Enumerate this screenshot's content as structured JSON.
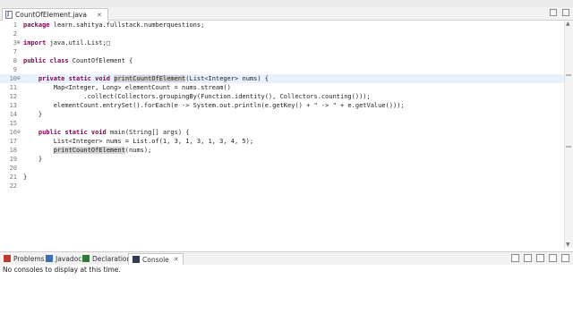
{
  "editor": {
    "tab_title": "CountOfElement.java",
    "tab_close": "✕",
    "current_line": 10,
    "lines": [
      {
        "n": "1",
        "fold": "",
        "segs": [
          {
            "t": "package",
            "k": 1
          },
          {
            "t": " learn.sahitya.fullstack.numberquestions;"
          }
        ]
      },
      {
        "n": "2",
        "fold": "",
        "segs": []
      },
      {
        "n": "3",
        "fold": "⊕",
        "segs": [
          {
            "t": "import",
            "k": 1
          },
          {
            "t": " java.util.List;□"
          }
        ]
      },
      {
        "n": "7",
        "fold": "",
        "segs": []
      },
      {
        "n": "8",
        "fold": "",
        "segs": [
          {
            "t": "public",
            "k": 1
          },
          {
            "t": " "
          },
          {
            "t": "class",
            "k": 1
          },
          {
            "t": " CountOfElement {"
          }
        ]
      },
      {
        "n": "9",
        "fold": "",
        "segs": []
      },
      {
        "n": "10",
        "fold": "⊖",
        "segs": [
          {
            "t": "    "
          },
          {
            "t": "private",
            "k": 1
          },
          {
            "t": " "
          },
          {
            "t": "static",
            "k": 1
          },
          {
            "t": " "
          },
          {
            "t": "void",
            "k": 1
          },
          {
            "t": " "
          },
          {
            "t": "printCountOfElement",
            "h": 1
          },
          {
            "t": "(List<Integer> nums) {"
          }
        ]
      },
      {
        "n": "11",
        "fold": "",
        "segs": [
          {
            "t": "        Map<Integer, Long> elementCount = nums.stream()"
          }
        ]
      },
      {
        "n": "12",
        "fold": "",
        "segs": [
          {
            "t": "                .collect(Collectors.groupingBy(Function.identity(), Collectors.counting()));"
          }
        ]
      },
      {
        "n": "13",
        "fold": "",
        "segs": [
          {
            "t": "        elementCount.entrySet().forEach(e -> System.out.println(e.getKey() + \" -> \" + e.getValue()));"
          }
        ]
      },
      {
        "n": "14",
        "fold": "",
        "segs": [
          {
            "t": "    }"
          }
        ]
      },
      {
        "n": "15",
        "fold": "",
        "segs": []
      },
      {
        "n": "16",
        "fold": "⊖",
        "segs": [
          {
            "t": "    "
          },
          {
            "t": "public",
            "k": 1
          },
          {
            "t": " "
          },
          {
            "t": "static",
            "k": 1
          },
          {
            "t": " "
          },
          {
            "t": "void",
            "k": 1
          },
          {
            "t": " main(String[] args) {"
          }
        ]
      },
      {
        "n": "17",
        "fold": "",
        "segs": [
          {
            "t": "        List<Integer> nums = List.of(1, 3, 1, 3, 1, 3, 4, 5);"
          }
        ]
      },
      {
        "n": "18",
        "fold": "",
        "segs": [
          {
            "t": "        "
          },
          {
            "t": "printCountOfElement",
            "h": 1
          },
          {
            "t": "(nums);"
          }
        ]
      },
      {
        "n": "19",
        "fold": "",
        "segs": [
          {
            "t": "    }"
          }
        ]
      },
      {
        "n": "20",
        "fold": "",
        "segs": []
      },
      {
        "n": "21",
        "fold": "",
        "segs": [
          {
            "t": "}"
          }
        ]
      },
      {
        "n": "22",
        "fold": "",
        "segs": []
      }
    ]
  },
  "bottom_panel": {
    "tabs": [
      {
        "label": "Problems",
        "icon": "problems-icon",
        "active": false
      },
      {
        "label": "Javadoc",
        "icon": "javadoc-icon",
        "active": false
      },
      {
        "label": "Declaration",
        "icon": "declaration-icon",
        "active": false
      },
      {
        "label": "Console",
        "icon": "console-icon",
        "active": true,
        "close": "✕"
      }
    ],
    "console_message": "No consoles to display at this time."
  },
  "colors": {
    "keyword": "#7f0055",
    "current_line_bg": "#e8f2fe",
    "occurrence_highlight": "#d4d4d4",
    "problems_icon": "#c0392b",
    "javadoc_icon": "#3b6fb6",
    "declaration_icon": "#2e7d32",
    "console_icon": "#2c3e50"
  }
}
